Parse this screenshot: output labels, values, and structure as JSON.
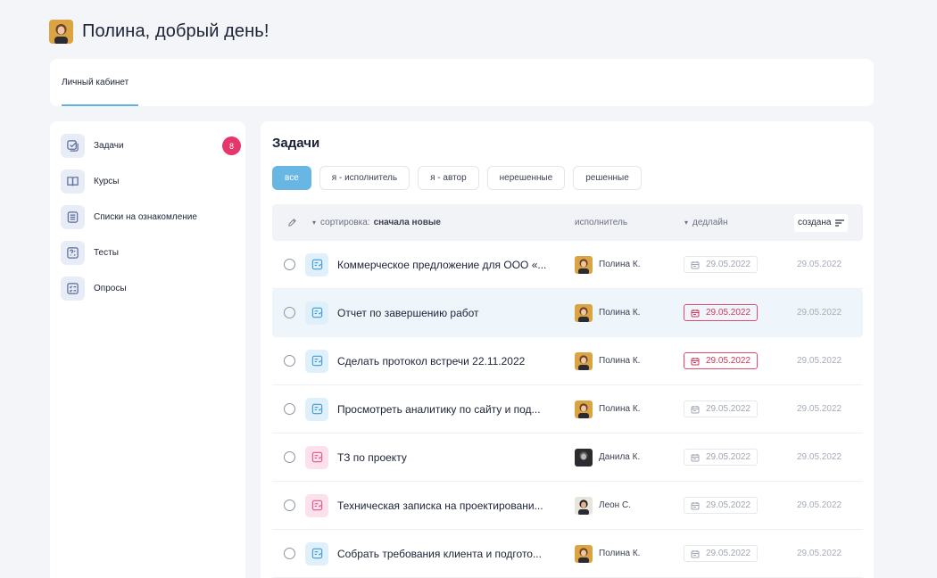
{
  "header": {
    "greeting": "Полина, добрый день!",
    "avatar": "user-avatar"
  },
  "tabs": [
    {
      "label": "Личный кабинет",
      "active": true
    }
  ],
  "sidebar": {
    "items": [
      {
        "label": "Задачи",
        "icon": "tasks-icon",
        "badge": "8",
        "active": true
      },
      {
        "label": "Курсы",
        "icon": "book-icon"
      },
      {
        "label": "Списки на ознакомление",
        "icon": "list-icon"
      },
      {
        "label": "Тесты",
        "icon": "test-icon"
      },
      {
        "label": "Опросы",
        "icon": "survey-icon"
      }
    ]
  },
  "main": {
    "title": "Задачи",
    "filters": [
      {
        "label": "все",
        "active": true
      },
      {
        "label": "я - исполнитель"
      },
      {
        "label": "я - автор"
      },
      {
        "label": "нерешенные"
      },
      {
        "label": "решенные"
      }
    ],
    "table": {
      "sort_label": "сортировка:",
      "sort_value": "сначала новые",
      "col_executor": "исполнитель",
      "col_deadline": "дедлайн",
      "col_created": "создана"
    },
    "rows": [
      {
        "title": "Коммерческое предложение для ООО «...",
        "executor": "Полина К.",
        "deadline": "29.05.2022",
        "created": "29.05.2022",
        "overdue": false,
        "color": "blue"
      },
      {
        "title": "Отчет по завершению работ",
        "executor": "Полина К.",
        "deadline": "29.05.2022",
        "created": "29.05.2022",
        "overdue": true,
        "color": "blue",
        "highlight": true
      },
      {
        "title": "Сделать протокол встречи 22.11.2022",
        "executor": "Полина К.",
        "deadline": "29.05.2022",
        "created": "29.05.2022",
        "overdue": true,
        "color": "blue"
      },
      {
        "title": "Просмотреть аналитику по сайту и под...",
        "executor": "Полина К.",
        "deadline": "29.05.2022",
        "created": "29.05.2022",
        "overdue": false,
        "color": "blue"
      },
      {
        "title": "ТЗ по проекту",
        "executor": "Данила К.",
        "deadline": "29.05.2022",
        "created": "29.05.2022",
        "overdue": false,
        "color": "pink"
      },
      {
        "title": "Техническая записка на проектировани...",
        "executor": "Леон С.",
        "deadline": "29.05.2022",
        "created": "29.05.2022",
        "overdue": false,
        "color": "pink"
      },
      {
        "title": "Собрать требования клиента и подгото...",
        "executor": "Полина К.",
        "deadline": "29.05.2022",
        "created": "29.05.2022",
        "overdue": false,
        "color": "blue"
      }
    ]
  },
  "colors": {
    "accent": "#67b6e3",
    "badge": "#e6366b",
    "overdue": "#e04a6d",
    "background": "#f4f5f9"
  }
}
